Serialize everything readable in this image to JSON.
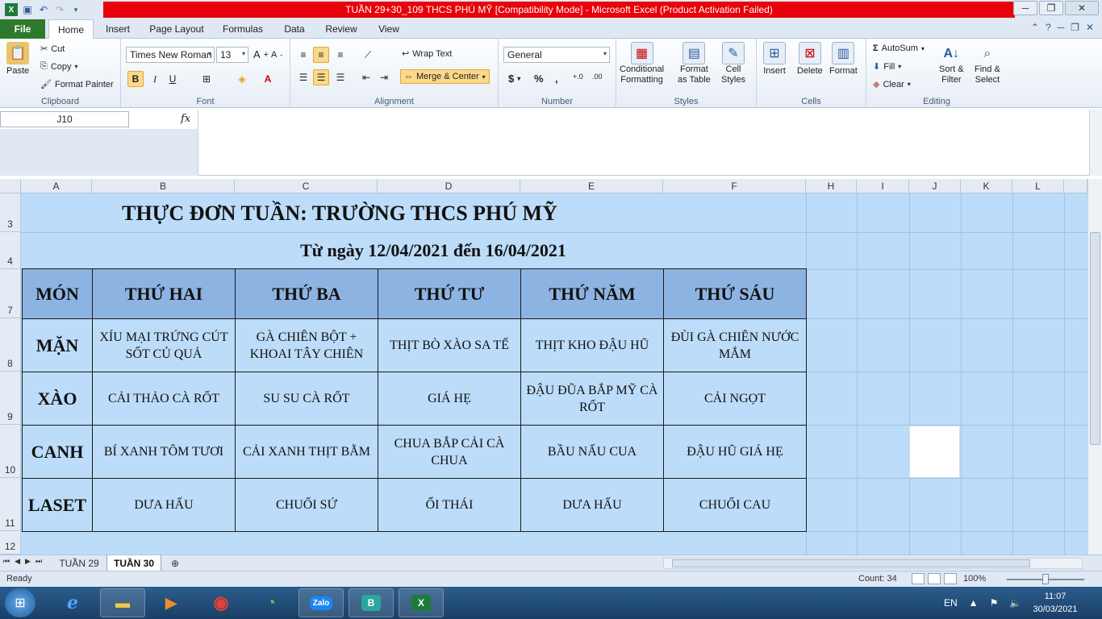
{
  "window": {
    "title": "TUẦN 29+30_109 THCS PHÚ MỸ  [Compatibility Mode]  -  Microsoft Excel (Product Activation Failed)"
  },
  "ribbon": {
    "tabs": [
      "File",
      "Home",
      "Insert",
      "Page Layout",
      "Formulas",
      "Data",
      "Review",
      "View"
    ],
    "clipboard": {
      "paste": "Paste",
      "cut": "Cut",
      "copy": "Copy",
      "format_painter": "Format Painter",
      "label": "Clipboard"
    },
    "font": {
      "name": "Times New Roman",
      "size": "13",
      "label": "Font"
    },
    "alignment": {
      "wrap_text": "Wrap Text",
      "merge_center": "Merge & Center",
      "label": "Alignment"
    },
    "number": {
      "format": "General",
      "label": "Number"
    },
    "styles": {
      "conditional": "Conditional",
      "formatting": "Formatting",
      "format_as": "Format",
      "as_table": "as Table",
      "cell": "Cell",
      "cell_styles": "Styles",
      "label": "Styles"
    },
    "cells": {
      "insert": "Insert",
      "delete": "Delete",
      "format": "Format",
      "label": "Cells"
    },
    "editing": {
      "autosum": "AutoSum",
      "fill": "Fill",
      "clear": "Clear",
      "sort": "Sort &",
      "filter": "Filter",
      "find": "Find &",
      "select": "Select",
      "label": "Editing"
    }
  },
  "formula_bar": {
    "name_box": "J10",
    "fx": "fx",
    "content": ""
  },
  "columns": [
    "A",
    "B",
    "C",
    "D",
    "E",
    "F",
    "H",
    "I",
    "J",
    "K",
    "L"
  ],
  "rows": [
    "3",
    "4",
    "7",
    "8",
    "9",
    "10",
    "11",
    "12"
  ],
  "sheet": {
    "title": "THỰC ĐƠN TUẦN: TRƯỜNG THCS PHÚ MỸ",
    "subtitle": "Từ ngày 12/04/2021 đến 16/04/2021",
    "table": {
      "headers": [
        "MÓN",
        "THỨ HAI",
        "THỨ BA",
        "THỨ TƯ",
        "THỨ NĂM",
        "THỨ SÁU"
      ],
      "rows": [
        [
          "MẶN",
          "XÍU MẠI TRỨNG CÚT SỐT CỦ QUẢ",
          "GÀ CHIÊN BỘT + KHOAI TÂY CHIÊN",
          "THỊT BÒ XÀO SA TẾ",
          "THỊT KHO ĐẬU HŨ",
          "ĐÙI GÀ CHIÊN NƯỚC MẮM"
        ],
        [
          "XÀO",
          "CẢI THẢO CÀ RỐT",
          "SU SU CÀ RỐT",
          "GIÁ HẸ",
          "ĐẬU ĐŨA BẮP MỸ CÀ RỐT",
          "CẢI NGỌT"
        ],
        [
          "CANH",
          "BÍ XANH TÔM TƯƠI",
          "CẢI XANH THỊT BẰM",
          "CHUA BẮP CẢI CÀ CHUA",
          "BẦU NẤU CUA",
          "ĐẬU HŨ GIÁ HẸ"
        ],
        [
          "LASET",
          "DƯA HẤU",
          "CHUỐI SỨ",
          "ỔI THÁI",
          "DƯA HẤU",
          "CHUỐI CAU"
        ]
      ]
    }
  },
  "sheet_tabs": [
    "TUẦN 29",
    "TUẦN 30"
  ],
  "status": {
    "ready": "Ready",
    "count": "Count: 34",
    "zoom": "100%"
  },
  "taskbar": {
    "lang": "EN",
    "time": "11:07",
    "date": "30/03/2021",
    "zalo": "Zalo",
    "b_app": "B"
  },
  "colors": {
    "sheet_bg": "#bcdcf9",
    "header_fill": "#8db3e2",
    "title_bar": "#e8000a",
    "file_tab": "#2d7a2c"
  }
}
